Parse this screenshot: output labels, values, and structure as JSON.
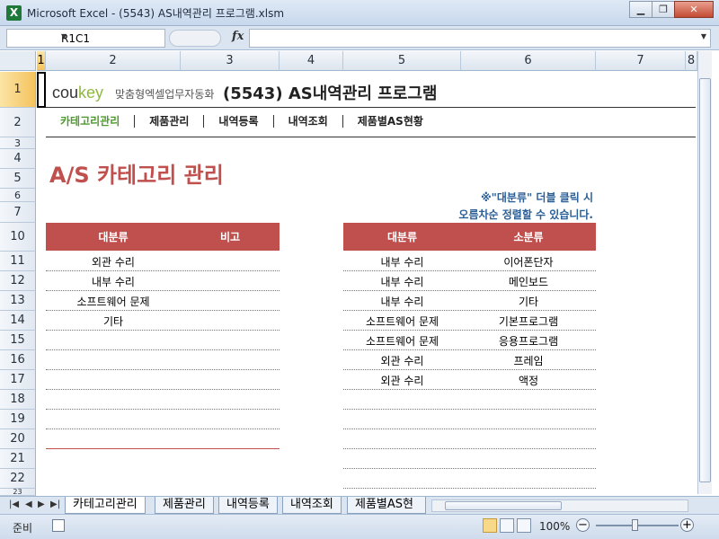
{
  "window": {
    "title": "Microsoft Excel - (5543) AS내역관리 프로그램.xlsm",
    "minimize": "▁",
    "restore": "❐",
    "close": "✕",
    "app_icon": "X"
  },
  "formula_bar": {
    "name_box": "R1C1",
    "fx_label": "fx",
    "value": ""
  },
  "columns": [
    "1",
    "2",
    "3",
    "4",
    "5",
    "6",
    "7",
    "8"
  ],
  "rows": [
    "1",
    "2",
    "3",
    "4",
    "5",
    "6",
    "7",
    "10",
    "11",
    "12",
    "13",
    "14",
    "15",
    "16",
    "17",
    "18",
    "19",
    "20",
    "21",
    "22",
    "23"
  ],
  "header": {
    "logo_main": "cou",
    "logo_key": "key",
    "logo_sub": "맞춤형엑셀업무자동화",
    "program_title": "(5543) AS내역관리 프로그램"
  },
  "nav": [
    "카테고리관리",
    "제품관리",
    "내역등록",
    "내역조회",
    "제품별AS현황"
  ],
  "page_heading": "A/S 카테고리 관리",
  "hint": {
    "line1": "※\"대분류\" 더블 클릭 시",
    "line2": "오름차순 정렬할 수 있습니다."
  },
  "left_table": {
    "headers": [
      "대분류",
      "비고"
    ],
    "rows": [
      [
        "외관 수리",
        ""
      ],
      [
        "내부 수리",
        ""
      ],
      [
        "소프트웨어 문제",
        ""
      ],
      [
        "기타",
        ""
      ]
    ]
  },
  "right_table": {
    "headers": [
      "대분류",
      "소분류"
    ],
    "rows": [
      [
        "내부 수리",
        "이어폰단자"
      ],
      [
        "내부 수리",
        "메인보드"
      ],
      [
        "내부 수리",
        "기타"
      ],
      [
        "소프트웨어 문제",
        "기본프로그램"
      ],
      [
        "소프트웨어 문제",
        "응용프로그램"
      ],
      [
        "외관 수리",
        "프레임"
      ],
      [
        "외관 수리",
        "액정"
      ]
    ]
  },
  "sheet_tabs": [
    "카테고리관리",
    "제품관리",
    "내역등록",
    "내역조회",
    "제품별AS현"
  ],
  "status": {
    "ready": "준비",
    "zoom": "100%"
  }
}
